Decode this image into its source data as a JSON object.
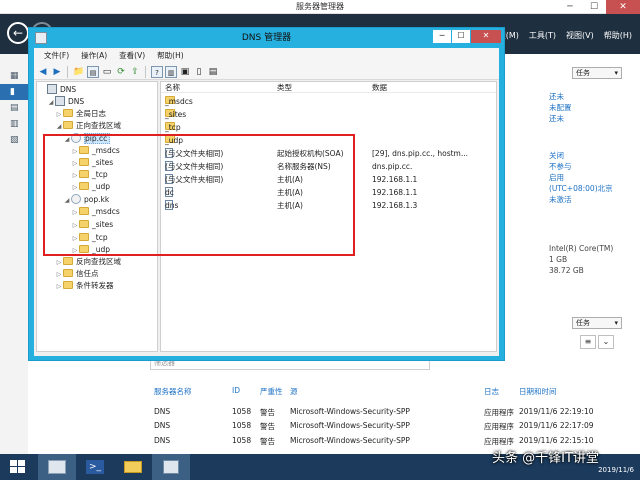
{
  "server_manager": {
    "title": "服务器管理器",
    "menus": [
      "管理(M)",
      "工具(T)",
      "视图(V)",
      "帮助(H)"
    ],
    "tasks_label": "任务",
    "props": {
      "group1": [
        "还未",
        "未配置",
        "还未"
      ],
      "group2": [
        "关闭",
        "不参与",
        "启用",
        "(UTC+08:00)北京",
        "未激活"
      ],
      "group3": [
        "Intel(R) Core(TM)",
        "1 GB",
        "38.72 GB"
      ]
    },
    "events": {
      "filter_placeholder": "筛选器",
      "columns": [
        "服务器名称",
        "ID",
        "严重性",
        "源",
        "日志",
        "日期和时间"
      ],
      "rows": [
        [
          "DNS",
          "1058",
          "警告",
          "Microsoft-Windows-Security-SPP",
          "应用程序",
          "2019/11/6 22:19:10"
        ],
        [
          "DNS",
          "1058",
          "警告",
          "Microsoft-Windows-Security-SPP",
          "应用程序",
          "2019/11/6 22:17:09"
        ],
        [
          "DNS",
          "1058",
          "警告",
          "Microsoft-Windows-Security-SPP",
          "应用程序",
          "2019/11/6 22:15:10"
        ]
      ]
    }
  },
  "dns_manager": {
    "title": "DNS 管理器",
    "menus": [
      "文件(F)",
      "操作(A)",
      "查看(V)",
      "帮助(H)"
    ],
    "tree": {
      "root": "DNS",
      "server": "DNS",
      "global_logs": "全局日志",
      "forward_zones": "正向查找区域",
      "zone1": "pip.cc",
      "zone1_children": [
        "_msdcs",
        "_sites",
        "_tcp",
        "_udp"
      ],
      "zone2": "pop.kk",
      "zone2_children": [
        "_msdcs",
        "_sites",
        "_tcp",
        "_udp"
      ],
      "reverse_zones": "反向查找区域",
      "trust_points": "信任点",
      "conditional_forwarders": "条件转发器"
    },
    "list": {
      "columns": [
        "名称",
        "类型",
        "数据"
      ],
      "folders": [
        "_msdcs",
        "_sites",
        "_tcp",
        "_udp"
      ],
      "records": [
        {
          "name": "(与父文件夹相同)",
          "type": "起始授权机构(SOA)",
          "data": "[29], dns.pip.cc., hostm..."
        },
        {
          "name": "(与父文件夹相同)",
          "type": "名称服务器(NS)",
          "data": "dns.pip.cc."
        },
        {
          "name": "(与父文件夹相同)",
          "type": "主机(A)",
          "data": "192.168.1.1"
        },
        {
          "name": "dc",
          "type": "主机(A)",
          "data": "192.168.1.1"
        },
        {
          "name": "dns",
          "type": "主机(A)",
          "data": "192.168.1.3"
        }
      ]
    }
  },
  "taskbar": {
    "date": "2019/11/6"
  },
  "watermark": "头条 @千锋IT讲堂"
}
